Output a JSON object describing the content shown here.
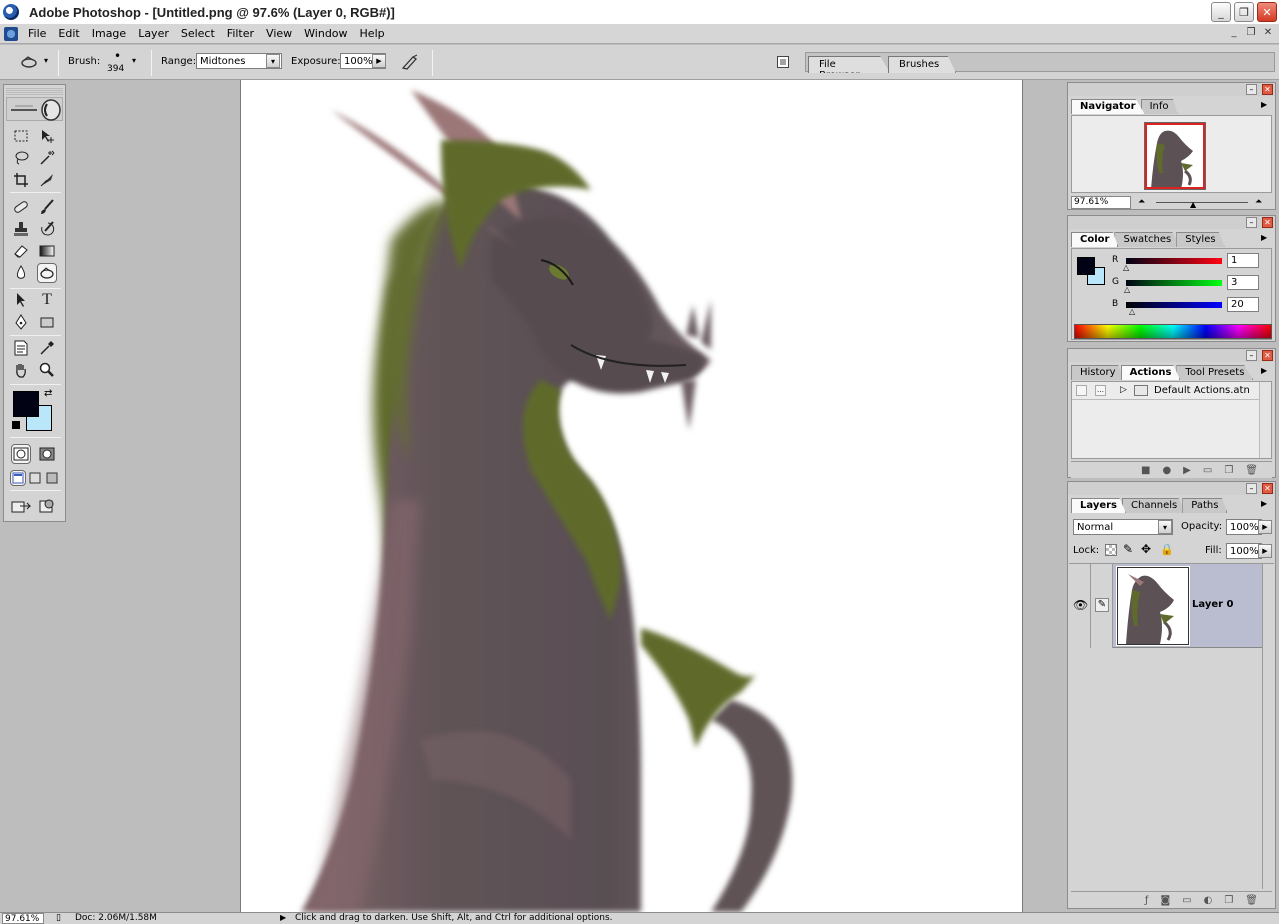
{
  "titlebar": {
    "title": "Adobe Photoshop - [Untitled.png @ 97.6% (Layer 0, RGB#)]"
  },
  "menubar": {
    "items": [
      "File",
      "Edit",
      "Image",
      "Layer",
      "Select",
      "Filter",
      "View",
      "Window",
      "Help"
    ]
  },
  "options": {
    "brush_label": "Brush:",
    "brush_size": "394",
    "range_label": "Range:",
    "range_value": "Midtones",
    "exposure_label": "Exposure:",
    "exposure_value": "100%",
    "well_tabs": [
      "File Browser",
      "Brushes"
    ]
  },
  "navigator": {
    "tabs": [
      "Navigator",
      "Info"
    ],
    "zoom": "97.61%"
  },
  "color": {
    "tabs": [
      "Color",
      "Swatches",
      "Styles"
    ],
    "channels": [
      {
        "label": "R",
        "value": "1"
      },
      {
        "label": "G",
        "value": "3"
      },
      {
        "label": "B",
        "value": "20"
      }
    ],
    "foreground": "#010314",
    "background": "#b9e6f8"
  },
  "actions": {
    "tabs": [
      "History",
      "Actions",
      "Tool Presets"
    ],
    "items": [
      "Default Actions.atn"
    ]
  },
  "layers": {
    "tabs": [
      "Layers",
      "Channels",
      "Paths"
    ],
    "blend_mode": "Normal",
    "opacity_label": "Opacity:",
    "opacity": "100%",
    "lock_label": "Lock:",
    "fill_label": "Fill:",
    "fill": "100%",
    "layer_name": "Layer 0"
  },
  "statusbar": {
    "zoom": "97.61%",
    "doc": "Doc: 2.06M/1.58M",
    "hint": "Click and drag to darken. Use Shift, Alt, and Ctrl for additional options."
  },
  "colors": {
    "dragon_body": "#5c5155",
    "dragon_mane": "#5f6a2c",
    "dragon_ears": "#9b7778"
  }
}
